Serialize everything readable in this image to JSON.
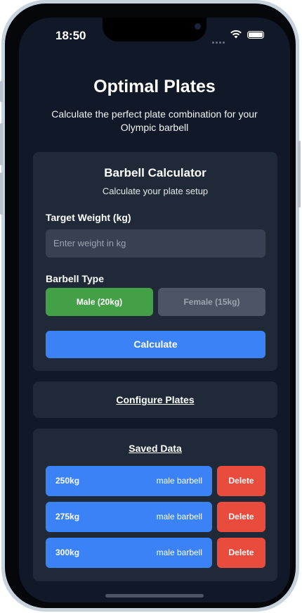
{
  "status": {
    "time": "18:50"
  },
  "header": {
    "title": "Optimal Plates",
    "subtitle": "Calculate the perfect plate combination for your Olympic barbell"
  },
  "calculator": {
    "title": "Barbell Calculator",
    "subtitle": "Calculate your plate setup",
    "weight_label": "Target Weight (kg)",
    "weight_placeholder": "Enter weight in kg",
    "barbell_label": "Barbell Type",
    "male_option": "Male (20kg)",
    "female_option": "Female (15kg)",
    "selected": "Male (20kg)",
    "calculate_label": "Calculate"
  },
  "configure": {
    "label": "Configure Plates"
  },
  "saved": {
    "title": "Saved Data",
    "delete_label": "Delete",
    "items": [
      {
        "weight": "250kg",
        "type": "male barbell"
      },
      {
        "weight": "275kg",
        "type": "male barbell"
      },
      {
        "weight": "300kg",
        "type": "male barbell"
      }
    ]
  },
  "colors": {
    "background": "#111827",
    "card": "#1f2937",
    "primary": "#3b82f6",
    "selected": "#43a047",
    "danger": "#e94b3c"
  }
}
